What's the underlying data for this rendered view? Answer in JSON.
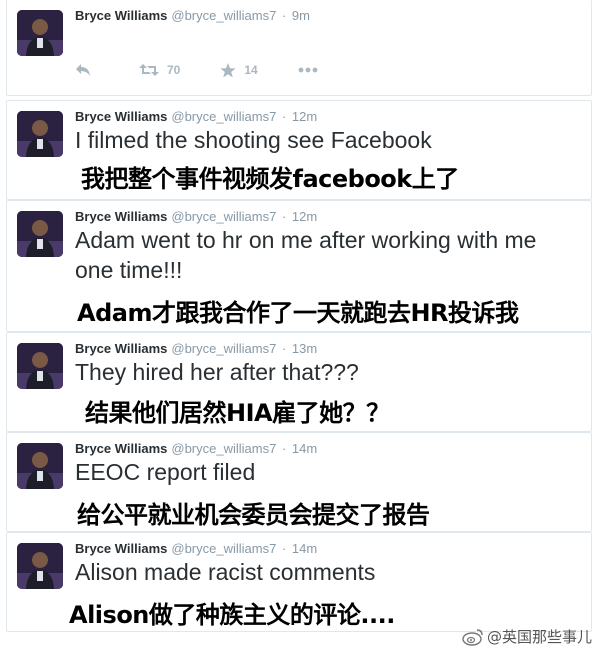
{
  "tweets": [
    {
      "name": "Bryce Williams",
      "handle": "@bryce_williams7",
      "dot": "·",
      "time": "9m",
      "text": "",
      "translation": "",
      "actions": {
        "retweets": "70",
        "favorites": "14"
      }
    },
    {
      "name": "Bryce Williams",
      "handle": "@bryce_williams7",
      "dot": "·",
      "time": "12m",
      "text": "I filmed the shooting see Facebook",
      "translation": "我把整个事件视频发facebook上了"
    },
    {
      "name": "Bryce Williams",
      "handle": "@bryce_williams7",
      "dot": "·",
      "time": "12m",
      "text": "Adam went to hr on me after working with me one time!!!",
      "translation": "Adam才跟我合作了一天就跑去HR投诉我"
    },
    {
      "name": "Bryce Williams",
      "handle": "@bryce_williams7",
      "dot": "·",
      "time": "13m",
      "text": "They hired her after that???",
      "translation": "结果他们居然HIA雇了她？？"
    },
    {
      "name": "Bryce Williams",
      "handle": "@bryce_williams7",
      "dot": "·",
      "time": "14m",
      "text": "EEOC report filed",
      "translation": "给公平就业机会委员会提交了报告"
    },
    {
      "name": "Bryce Williams",
      "handle": "@bryce_williams7",
      "dot": "·",
      "time": "14m",
      "text": "Alison made racist comments",
      "translation": "Alison做了种族主义的评论...."
    }
  ],
  "watermark": {
    "text": "@英国那些事儿",
    "icon": "weibo-icon"
  },
  "icons": {
    "reply": "reply-icon",
    "retweet": "retweet-icon",
    "favorite": "star-icon",
    "more": "more-icon"
  },
  "colors": {
    "name": "#292f33",
    "meta": "#8899a6",
    "action": "#aab8c2",
    "border": "#e1e8ed"
  }
}
